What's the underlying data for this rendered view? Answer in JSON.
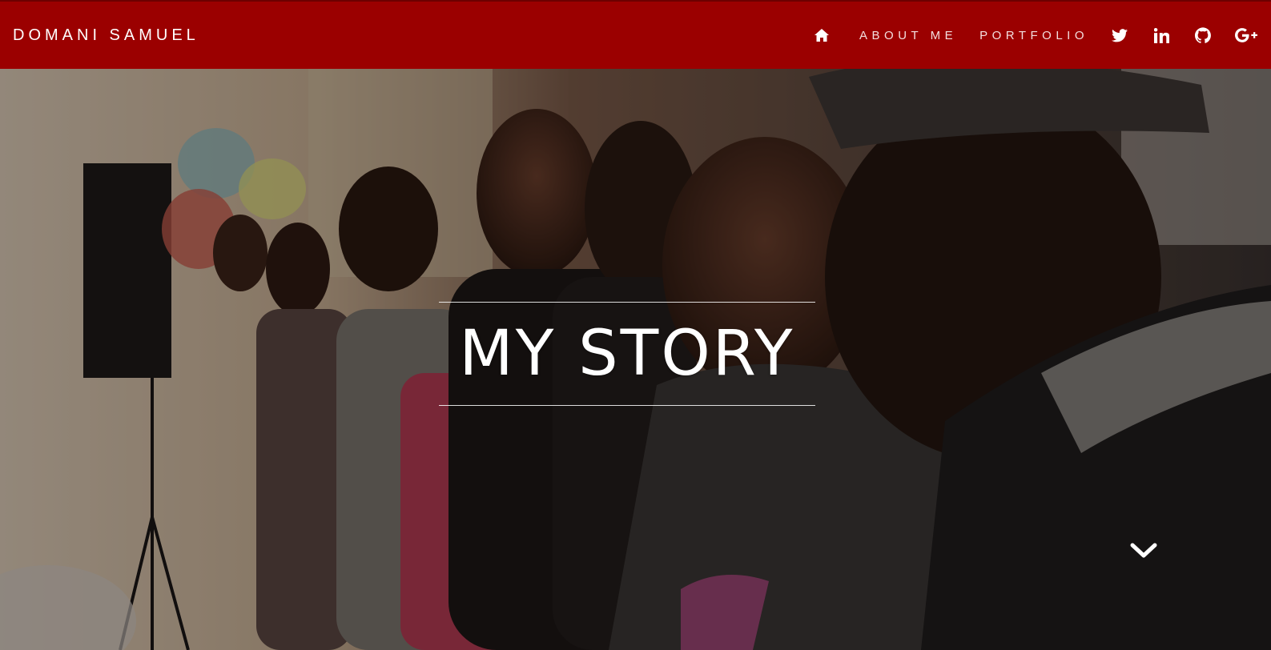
{
  "navbar": {
    "brand": "DOMANI SAMUEL",
    "background_color": "#9b0000",
    "home_icon": "home-icon",
    "links": [
      {
        "label": "ABOUT ME"
      },
      {
        "label": "PORTFOLIO"
      }
    ],
    "social_icons": [
      "twitter-icon",
      "linkedin-icon",
      "github-icon",
      "google-plus-icon"
    ]
  },
  "hero": {
    "title": "MY STORY",
    "scroll_icon": "chevron-down-icon"
  }
}
